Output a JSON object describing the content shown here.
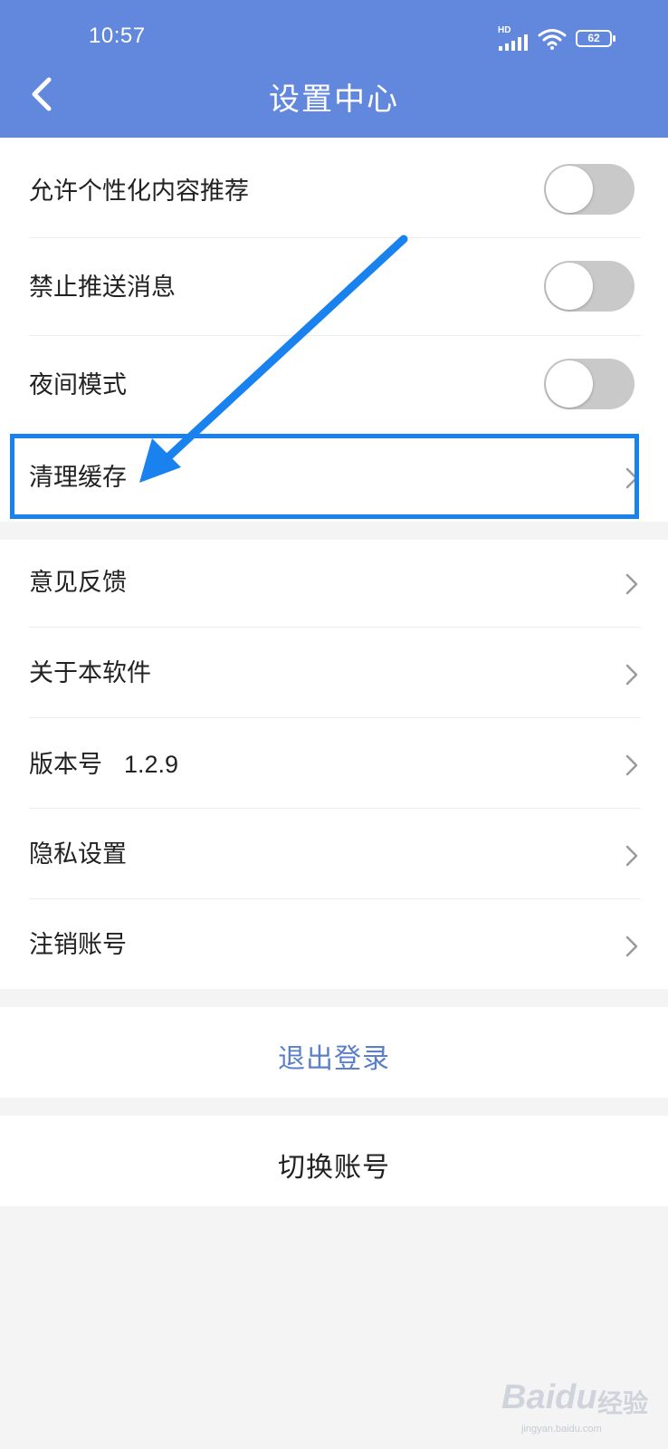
{
  "status_bar": {
    "time": "10:57",
    "network": "HD",
    "battery": "62"
  },
  "header": {
    "title": "设置中心",
    "back_icon": "chevron-left-icon",
    "background": "#6288de"
  },
  "settings_toggles": [
    {
      "label": "允许个性化内容推荐",
      "on": false
    },
    {
      "label": "禁止推送消息",
      "on": false
    },
    {
      "label": "夜间模式",
      "on": false
    }
  ],
  "clear_cache": {
    "label": "清理缓存",
    "icon": "chevron-right-icon"
  },
  "info_items": [
    {
      "label": "意见反馈",
      "icon": "chevron-right-icon"
    },
    {
      "label": "关于本软件",
      "icon": "chevron-right-icon"
    },
    {
      "label": "版本号",
      "value": "1.2.9",
      "icon": "chevron-right-icon"
    },
    {
      "label": "隐私设置",
      "icon": "chevron-right-icon"
    },
    {
      "label": "注销账号",
      "icon": "chevron-right-icon"
    }
  ],
  "logout": {
    "label": "退出登录",
    "color": "#5b7fc9"
  },
  "switch_account": {
    "label": "切换账号",
    "color": "#222222"
  },
  "annotation": {
    "highlight_color": "#1a82ef"
  },
  "watermark": {
    "brand": "Baidu",
    "cn": "经验",
    "url": "jingyan.baidu.com"
  }
}
